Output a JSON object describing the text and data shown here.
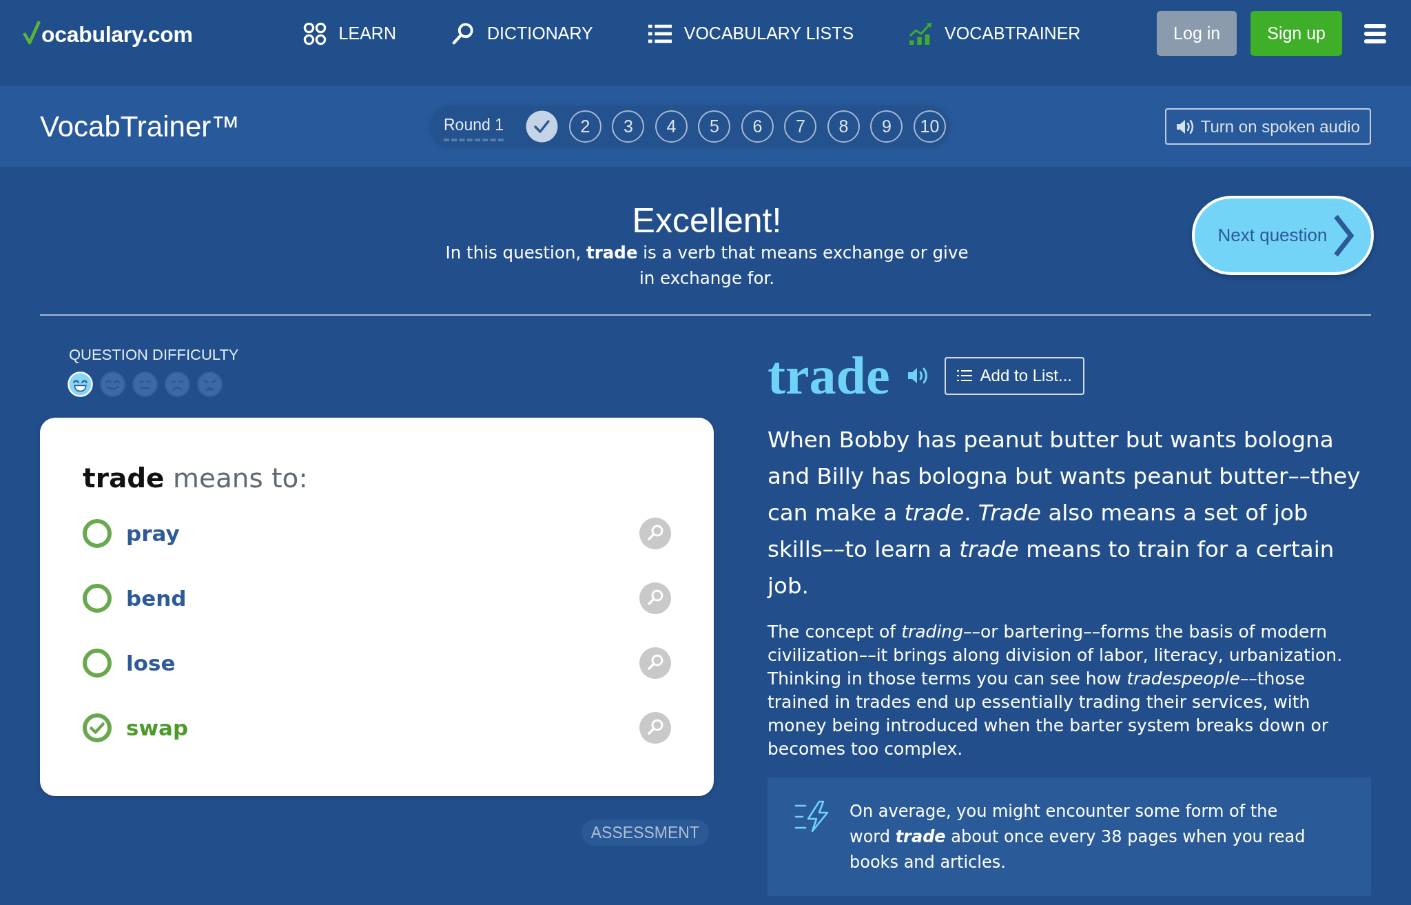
{
  "header": {
    "logo": "ocabulary.com",
    "nav": [
      {
        "label": "LEARN",
        "kind": "learn"
      },
      {
        "label": "DICTIONARY",
        "kind": "dictionary"
      },
      {
        "label": "VOCABULARY LISTS",
        "kind": "lists"
      },
      {
        "label": "VOCABTRAINER",
        "kind": "trainer"
      }
    ],
    "buttons": [
      {
        "label": "Log in",
        "kind": "secondary"
      },
      {
        "label": "Sign up",
        "kind": "primary"
      }
    ]
  },
  "trainer_bar": {
    "title": "VocabTrainer™",
    "round_label": "Round 1",
    "questions": [
      {
        "done": true
      },
      {
        "label": "2",
        "done": false
      },
      {
        "label": "3",
        "done": false
      },
      {
        "label": "4",
        "done": false
      },
      {
        "label": "5",
        "done": false
      },
      {
        "label": "6",
        "done": false
      },
      {
        "label": "7",
        "done": false
      },
      {
        "label": "8",
        "done": false
      },
      {
        "label": "9",
        "done": false
      },
      {
        "label": "10",
        "done": false
      }
    ],
    "audio_button": "Turn on spoken audio"
  },
  "feedback": {
    "title": "Excellent!",
    "message": "In this question, **trade** is a verb that means exchange or give in exchange for.",
    "next_button": "Next question"
  },
  "difficulty": {
    "label": "QUESTION DIFFICULTY",
    "levels": [
      {
        "kind": "grin",
        "selected": true
      },
      {
        "kind": "smile",
        "selected": false
      },
      {
        "kind": "neutral",
        "selected": false
      },
      {
        "kind": "frown",
        "selected": false
      },
      {
        "kind": "angry",
        "selected": false
      }
    ]
  },
  "question": {
    "prompt": "**trade** means to:",
    "options": [
      {
        "label": "pray",
        "selected": false
      },
      {
        "label": "bend",
        "selected": false
      },
      {
        "label": "lose",
        "selected": false
      },
      {
        "label": "swap",
        "selected": true
      }
    ],
    "tag": "ASSESSMENT"
  },
  "word": {
    "headword": "trade",
    "add_button": "Add to List...",
    "short_definition": "When Bobby has peanut butter but wants bologna and Billy has bologna but wants peanut butter––they can make a *trade*. *Trade* also means a set of job skills––to learn a *trade* means to train for a certain job.",
    "long_definition": "The concept of *trading*––or bartering––forms the basis of modern civilization––it brings along division of labor, literacy, urbanization. Thinking in those terms you can see how *tradespeople*––those trained in trades end up essentially trading their services, with money being introduced when the barter system breaks down or becomes too complex.",
    "frequency_note": "On average, you might encounter some form of the word **trade** about once every 38 pages when you read books and articles."
  }
}
